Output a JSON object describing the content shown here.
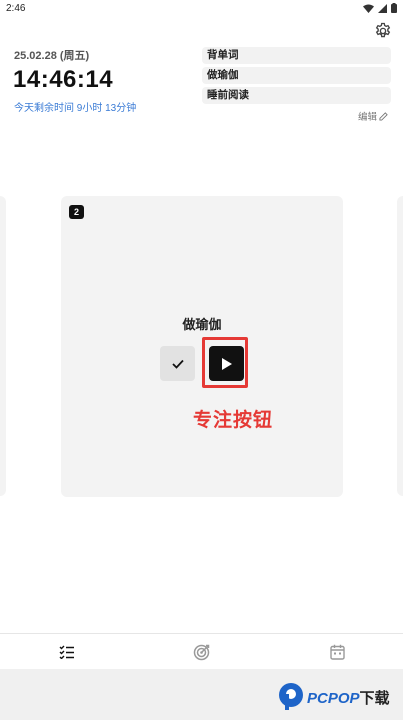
{
  "status_bar": {
    "time": "2:46"
  },
  "header": {
    "date": "25.02.28 (周五)",
    "clock": "14:46:14",
    "remaining": "今天剩余时间 9小时 13分钟"
  },
  "tasks": {
    "items": [
      "背单词",
      "做瑜伽",
      "睡前阅读"
    ],
    "edit_label": "编辑"
  },
  "card": {
    "badge": "2",
    "title": "做瑜伽",
    "annotation": "专注按钮"
  },
  "watermark": {
    "brand": "PCPOP",
    "suffix": "下载"
  },
  "colors": {
    "accent_blue": "#3a7bd5",
    "annotation_red": "#e53935"
  },
  "icons": {
    "settings": "gear-icon",
    "check": "check-icon",
    "play": "play-icon",
    "nav": [
      "checklist-icon",
      "target-icon",
      "calendar-icon"
    ]
  }
}
